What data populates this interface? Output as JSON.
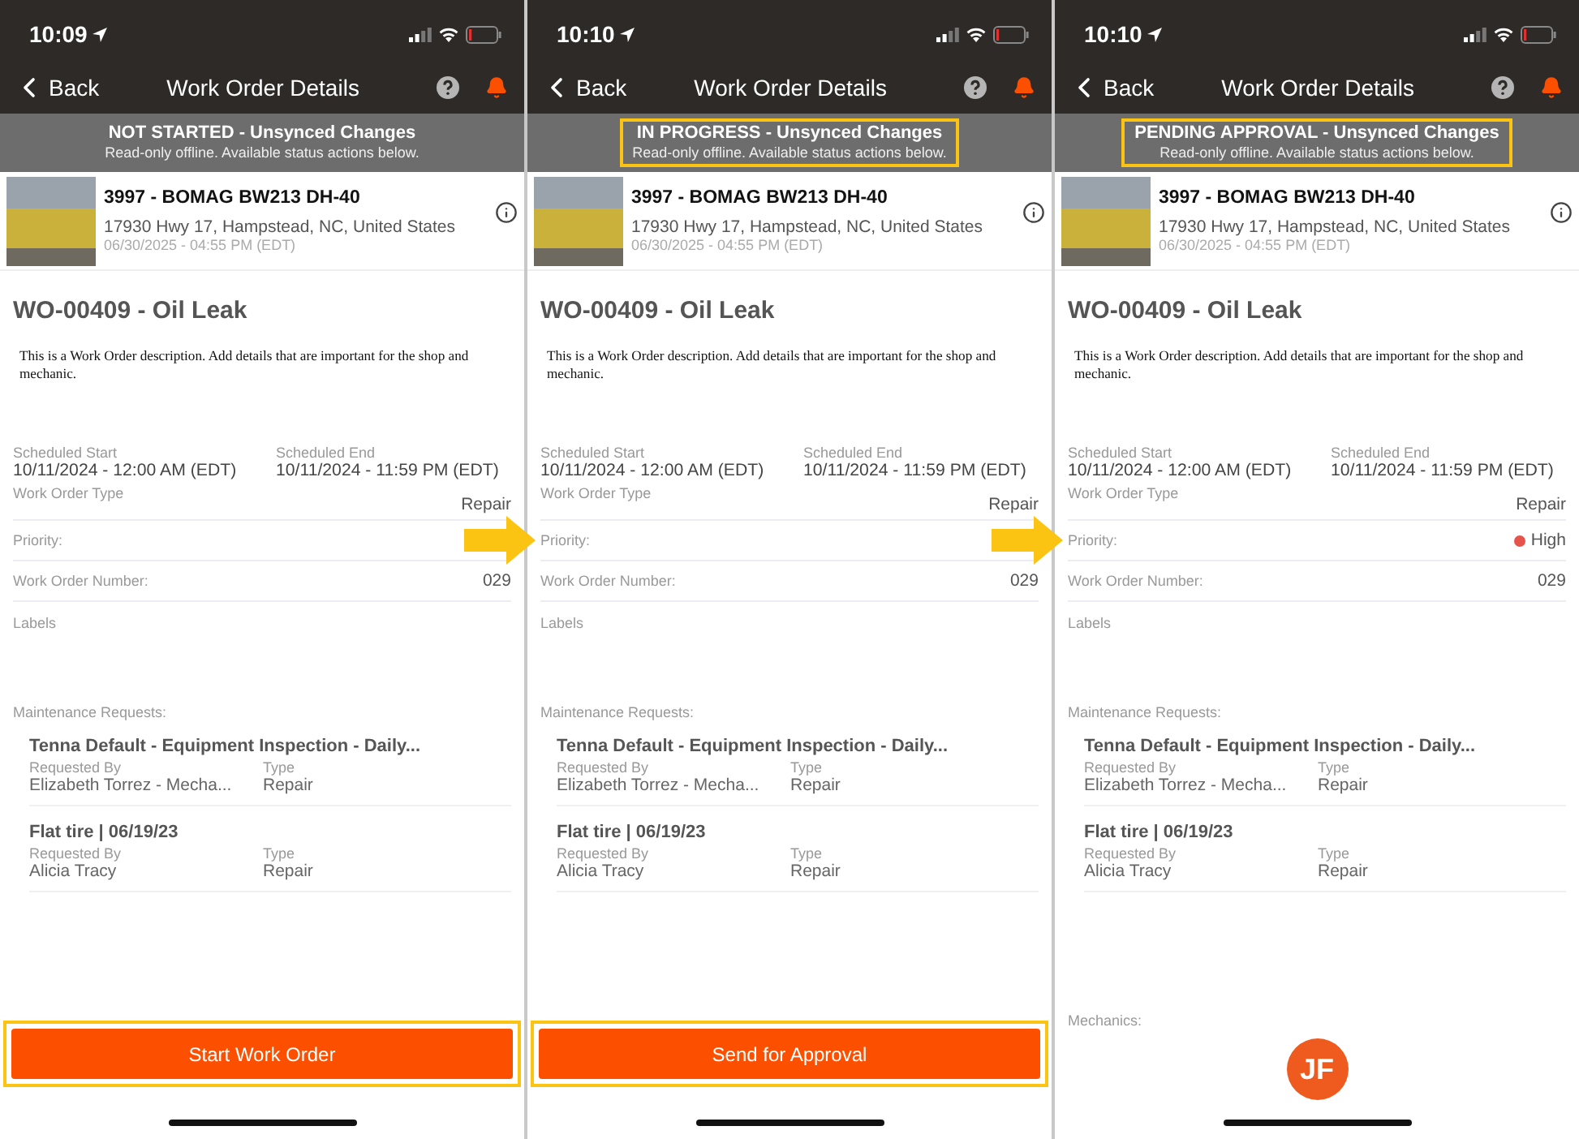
{
  "panels": [
    {
      "status_bar": {
        "time": "10:09"
      },
      "nav": {
        "back": "Back",
        "title": "Work Order Details"
      },
      "banner": {
        "status": "NOT STARTED - Unsynced Changes",
        "note": "Read-only offline. Available status actions below.",
        "highlighted": false
      },
      "asset": {
        "name": "3997 - BOMAG BW213 DH-40",
        "address": "17930 Hwy 17, Hampstead, NC, United States",
        "timestamp": "06/30/2025 - 04:55 PM (EDT)"
      },
      "work_order": {
        "title": "WO-00409 - Oil Leak",
        "description": "This is a Work Order description. Add details that are important for the shop and mechanic.",
        "schedule": [
          {
            "label": "Scheduled Start",
            "value": "10/11/2024 - 12:00 AM (EDT)"
          },
          {
            "label": "Scheduled End",
            "value": "10/11/2024 - 11:59 PM (EDT)"
          }
        ],
        "fields": [
          {
            "label": "Work Order Type",
            "value": "Repair"
          },
          {
            "label": "Priority:"
          },
          {
            "label": "Work Order Number:",
            "value": "029"
          },
          {
            "label": "Labels"
          }
        ]
      },
      "maintenance": {
        "heading": "Maintenance Requests:",
        "requests": [
          {
            "title": "Tenna Default - Equipment Inspection - Daily...",
            "requested_by_label": "Requested By",
            "requested_by": "Elizabeth Torrez - Mecha...",
            "type_label": "Type",
            "type": "Repair"
          },
          {
            "title": "Flat tire | 06/19/23",
            "requested_by_label": "Requested By",
            "requested_by": "Alicia Tracy",
            "type_label": "Type",
            "type": "Repair"
          }
        ]
      },
      "footer": {
        "kind": "button",
        "label": "Start Work Order",
        "highlighted": true
      }
    },
    {
      "status_bar": {
        "time": "10:10"
      },
      "nav": {
        "back": "Back",
        "title": "Work Order Details"
      },
      "banner": {
        "status": "IN PROGRESS - Unsynced Changes",
        "note": "Read-only offline. Available status actions below.",
        "highlighted": true
      },
      "asset": {
        "name": "3997 - BOMAG BW213 DH-40",
        "address": "17930 Hwy 17, Hampstead, NC, United States",
        "timestamp": "06/30/2025 - 04:55 PM (EDT)"
      },
      "work_order": {
        "title": "WO-00409 - Oil Leak",
        "description": "This is a Work Order description. Add details that are important for the shop and mechanic.",
        "schedule": [
          {
            "label": "Scheduled Start",
            "value": "10/11/2024 - 12:00 AM (EDT)"
          },
          {
            "label": "Scheduled End",
            "value": "10/11/2024 - 11:59 PM (EDT)"
          }
        ],
        "fields": [
          {
            "label": "Work Order Type",
            "value": "Repair"
          },
          {
            "label": "Priority:"
          },
          {
            "label": "Work Order Number:",
            "value": "029"
          },
          {
            "label": "Labels"
          }
        ]
      },
      "maintenance": {
        "heading": "Maintenance Requests:",
        "requests": [
          {
            "title": "Tenna Default - Equipment Inspection - Daily...",
            "requested_by_label": "Requested By",
            "requested_by": "Elizabeth Torrez - Mecha...",
            "type_label": "Type",
            "type": "Repair"
          },
          {
            "title": "Flat tire | 06/19/23",
            "requested_by_label": "Requested By",
            "requested_by": "Alicia Tracy",
            "type_label": "Type",
            "type": "Repair"
          }
        ]
      },
      "footer": {
        "kind": "button",
        "label": "Send for Approval",
        "highlighted": true
      }
    },
    {
      "status_bar": {
        "time": "10:10"
      },
      "nav": {
        "back": "Back",
        "title": "Work Order Details"
      },
      "banner": {
        "status": "PENDING APPROVAL - Unsynced Changes",
        "note": "Read-only offline. Available status actions below.",
        "highlighted": true
      },
      "asset": {
        "name": "3997 - BOMAG BW213 DH-40",
        "address": "17930 Hwy 17, Hampstead, NC, United States",
        "timestamp": "06/30/2025 - 04:55 PM (EDT)"
      },
      "work_order": {
        "title": "WO-00409 - Oil Leak",
        "description": "This is a Work Order description. Add details that are important for the shop and mechanic.",
        "schedule": [
          {
            "label": "Scheduled Start",
            "value": "10/11/2024 - 12:00 AM (EDT)"
          },
          {
            "label": "Scheduled End",
            "value": "10/11/2024 - 11:59 PM (EDT)"
          }
        ],
        "fields": [
          {
            "label": "Work Order Type",
            "value": "Repair"
          },
          {
            "label": "Priority:",
            "value": "High",
            "color": "#e5534b"
          },
          {
            "label": "Work Order Number:",
            "value": "029"
          },
          {
            "label": "Labels"
          }
        ]
      },
      "maintenance": {
        "heading": "Maintenance Requests:",
        "requests": [
          {
            "title": "Tenna Default - Equipment Inspection - Daily...",
            "requested_by_label": "Requested By",
            "requested_by": "Elizabeth Torrez - Mecha...",
            "type_label": "Type",
            "type": "Repair"
          },
          {
            "title": "Flat tire | 06/19/23",
            "requested_by_label": "Requested By",
            "requested_by": "Alicia Tracy",
            "type_label": "Type",
            "type": "Repair"
          }
        ]
      },
      "footer": {
        "kind": "mechanics",
        "heading": "Mechanics:",
        "initials": "JF"
      }
    }
  ]
}
